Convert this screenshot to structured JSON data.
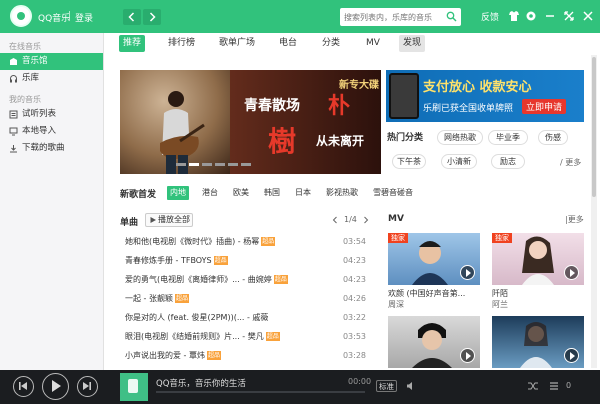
{
  "colors": {
    "brand": "#31c27c",
    "player_bg": "#1b1d20",
    "hq_badge": "#f9a23b",
    "mv_badge": "#f0421f"
  },
  "titlebar": {
    "app_name": "QQ音乐",
    "separator": "|",
    "login": "登录",
    "back_icon": "chevron-left-icon",
    "forward_icon": "chevron-right-icon",
    "search_placeholder": "搜索列表内，乐库的音乐",
    "feedback": "反馈"
  },
  "sidebar": {
    "section_online": "在线音乐",
    "online_items": [
      {
        "label": "音乐馆",
        "icon": "music-hall-icon"
      },
      {
        "label": "乐库",
        "icon": "headphones-icon"
      }
    ],
    "section_mine": "我的音乐",
    "mine_items": [
      {
        "label": "试听列表",
        "icon": "list-icon"
      },
      {
        "label": "本地导入",
        "icon": "computer-icon"
      },
      {
        "label": "下载的歌曲",
        "icon": "download-icon"
      }
    ]
  },
  "tabs": [
    "推荐",
    "排行榜",
    "歌单广场",
    "电台",
    "分类",
    "MV",
    "发现"
  ],
  "banner": {
    "tag": "新专大碟",
    "line1": "青春散场",
    "big1": "朴",
    "big2": "樹",
    "line2": "从未离开",
    "page": 2,
    "pages": 6
  },
  "ad": {
    "title": "支付放心 收款安心",
    "subtitle": "乐刷已获全国收单牌照",
    "button": "立即申请"
  },
  "hot": {
    "title": "热门分类",
    "tags": [
      "网络热歌",
      "毕业季",
      "伤感",
      "下午茶",
      "小清新",
      "励志"
    ],
    "more": "/ 更多"
  },
  "new_songs": {
    "title": "新歌首发",
    "regions": [
      "内地",
      "港台",
      "欧美",
      "韩国",
      "日本",
      "影视热歌",
      "雪碧音碰音"
    ]
  },
  "singles": {
    "title": "单曲",
    "play_all": "播放全部",
    "pager": "1/4",
    "hq_label": "超品",
    "songs": [
      {
        "name": "她和他(电视剧《微时代》插曲) - 杨幂",
        "duration": "03:54",
        "hq": true
      },
      {
        "name": "青春修炼手册 - TFBOYS",
        "duration": "04:23",
        "hq": true
      },
      {
        "name": "爱的勇气(电视剧《离婚律师》... - 曲婉婷",
        "duration": "04:23",
        "hq": true
      },
      {
        "name": "一起 - 张靓颖",
        "duration": "04:26",
        "hq": true
      },
      {
        "name": "你是对的人 (feat. 俊星(2PM))(... - 戚薇",
        "duration": "03:22",
        "hq": false
      },
      {
        "name": "眼泪(电视剧《结婚前规则》片... - 樊凡",
        "duration": "03:53",
        "hq": true
      },
      {
        "name": "小声说出我的爱 - 覃炜",
        "duration": "03:28",
        "hq": true
      }
    ]
  },
  "mv": {
    "title": "MV",
    "more": "|更多",
    "items": [
      {
        "title": "欢颜 (中国好声音第...",
        "artist": "周深",
        "badge": "独家"
      },
      {
        "title": "阡陌",
        "artist": "阿兰",
        "badge": "独家"
      },
      {
        "title": "",
        "artist": "",
        "badge": ""
      },
      {
        "title": "",
        "artist": "",
        "badge": ""
      }
    ]
  },
  "player": {
    "song": "QQ音乐，音乐你的生活",
    "time": "00:00",
    "quality": "标准",
    "playlist_count": "0"
  }
}
